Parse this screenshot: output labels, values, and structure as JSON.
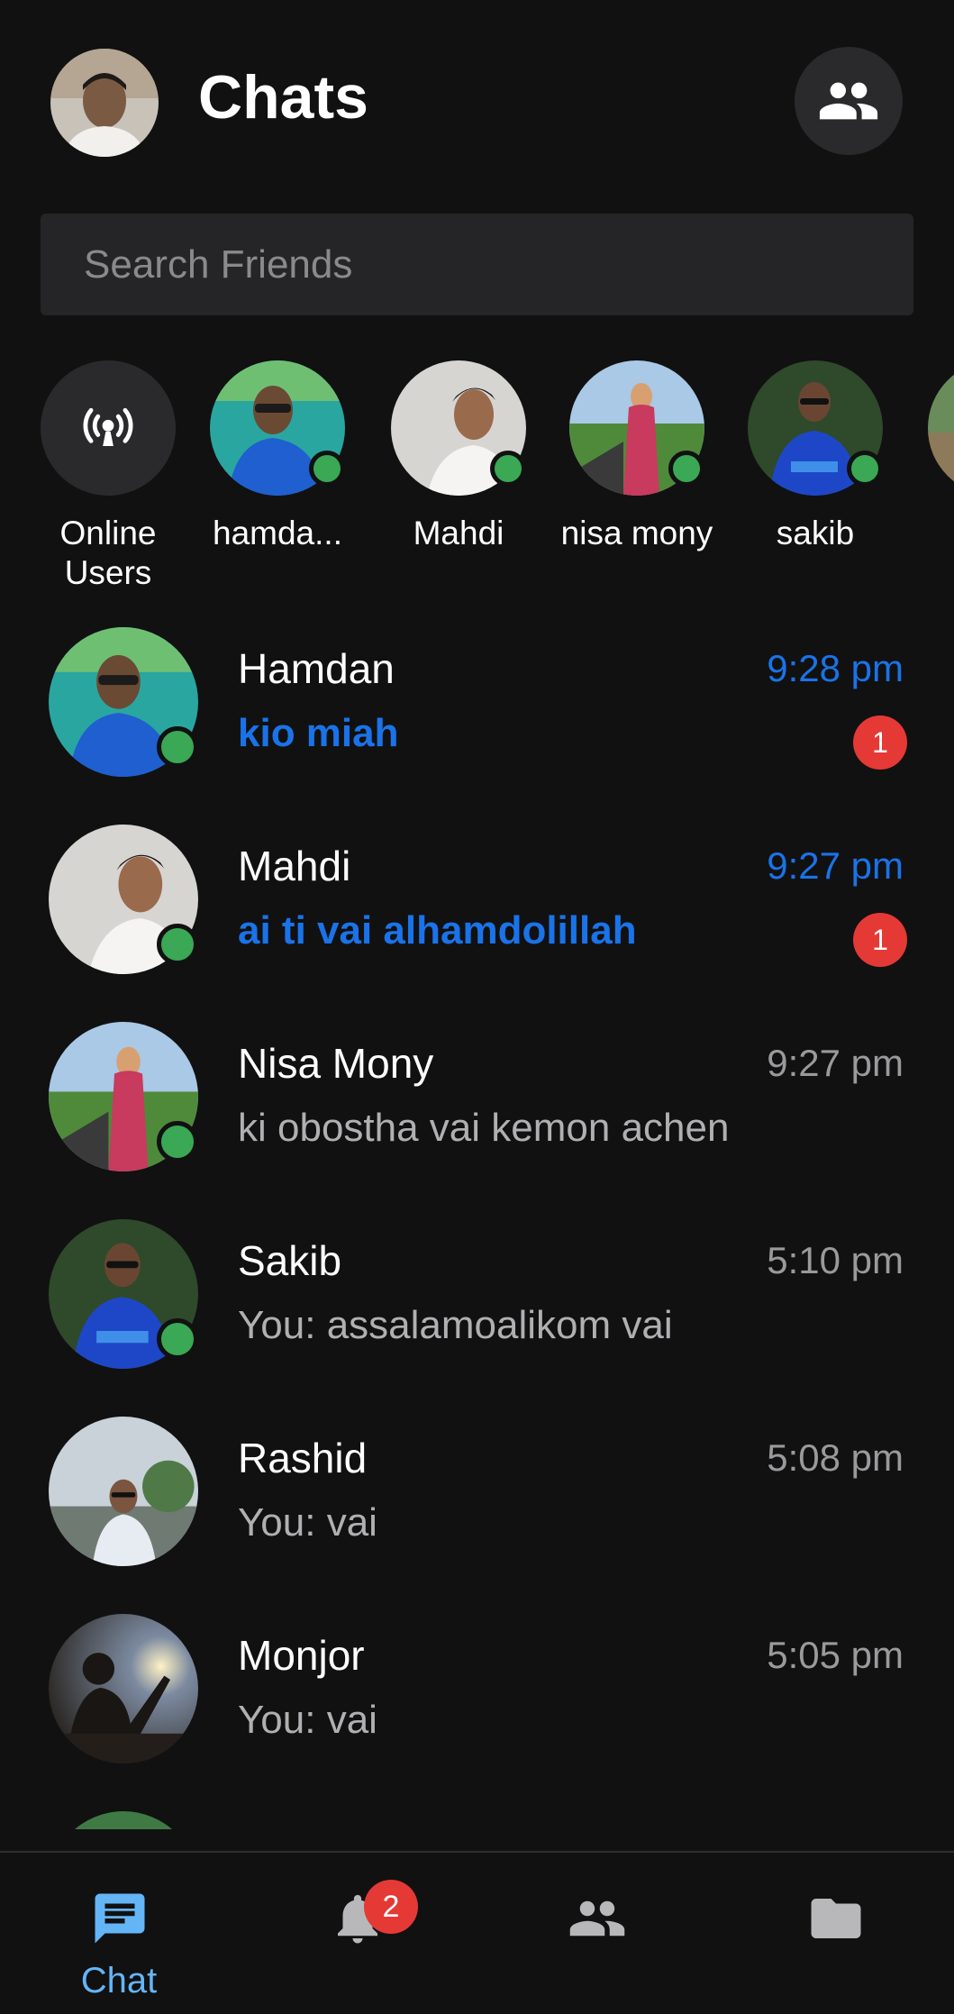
{
  "header": {
    "title": "Chats",
    "profile_avatar_alt": "profile photo"
  },
  "search": {
    "placeholder": "Search Friends"
  },
  "online_users": {
    "label": "Online Users",
    "items": [
      {
        "label": "hamda...",
        "avatar": "person-blue-shirt"
      },
      {
        "label": "Mahdi",
        "avatar": "person-white-shirt"
      },
      {
        "label": "nisa mony",
        "avatar": "person-pink-dress"
      },
      {
        "label": "sakib",
        "avatar": "person-blue-jersey"
      }
    ]
  },
  "chats": [
    {
      "name": "Hamdan",
      "time": "9:28 pm",
      "message": "kio miah",
      "unread": true,
      "badge": "1",
      "online": true
    },
    {
      "name": "Mahdi",
      "time": "9:27 pm",
      "message": "ai ti vai alhamdolillah",
      "unread": true,
      "badge": "1",
      "online": true
    },
    {
      "name": "Nisa Mony",
      "time": "9:27 pm",
      "message": "ki obostha vai kemon achen",
      "unread": false,
      "online": true
    },
    {
      "name": "Sakib",
      "time": "5:10 pm",
      "message": "You: assalamoalikom vai",
      "unread": false,
      "online": true
    },
    {
      "name": "Rashid",
      "time": "5:08 pm",
      "message": "You: vai",
      "unread": false,
      "online": false
    },
    {
      "name": "Monjor",
      "time": "5:05 pm",
      "message": "You: vai",
      "unread": false,
      "online": false
    }
  ],
  "bottom_nav": {
    "chat_label": "Chat",
    "notifications_badge": "2",
    "items": [
      "chat-icon",
      "bell-icon",
      "people-icon",
      "folder-icon"
    ]
  },
  "colors": {
    "background": "#111112",
    "accent": "#1a73e8",
    "nav_active": "#64b5f6",
    "online": "#3aa854",
    "badge": "#e53935",
    "muted_text": "#9a9a9c"
  }
}
